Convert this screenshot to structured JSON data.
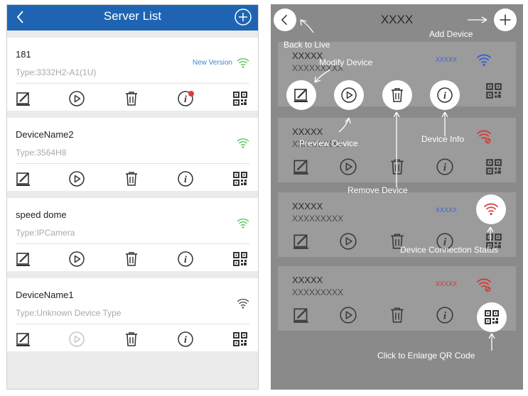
{
  "left_panel": {
    "header": {
      "title": "Server List",
      "back_icon": "chevron-left-icon",
      "add_icon": "circle-plus-icon"
    },
    "devices": [
      {
        "name": "181",
        "type": "Type:3332H2-A1(1U)",
        "badge": "New Version",
        "status_color": "#57c45d"
      },
      {
        "name": "DeviceName2",
        "type": "Type:3564H8",
        "badge": "",
        "status_color": "#57c45d"
      },
      {
        "name": "speed dome",
        "type": "Type:IPCamera",
        "badge": "",
        "status_color": "#57c45d"
      },
      {
        "name": "DeviceName1",
        "type": "Type:Unknown Device Type",
        "badge": "",
        "status_color": "#555555"
      }
    ],
    "action_icons": [
      "edit-icon",
      "play-icon",
      "trash-icon",
      "info-icon",
      "qr-code-icon"
    ],
    "accent_color": "#1e64b2"
  },
  "right_panel": {
    "title": "XXXX",
    "rows": [
      {
        "name": "XXXXX",
        "sub": "XXXXXXXXX",
        "mid": "XXXXX",
        "mid_color": "#3a66d8",
        "status_color": "#2f5fd2"
      },
      {
        "name": "XXXXX",
        "sub": "XXXXXXXXX",
        "mid": "",
        "mid_color": "",
        "status_color": "#d8342f"
      },
      {
        "name": "XXXXX",
        "sub": "XXXXXXXXX",
        "mid": "XXXXX",
        "mid_color": "#3a66d8",
        "status_color": "#e23a3a"
      },
      {
        "name": "XXXXX",
        "sub": "XXXXXXXXX",
        "mid": "XXXXX",
        "mid_color": "#d8342f",
        "status_color": "#d8342f"
      }
    ],
    "annotations": {
      "back_to_live": "Back to Live",
      "add_device": "Add Device",
      "modify_device": "Modify Device",
      "preview_device": "Preview Device",
      "device_info": "Device Info",
      "remove_device": "Remove Device",
      "connection_status": "Device Connection Status",
      "enlarge_qr": "Click to Enlarge QR Code"
    }
  }
}
